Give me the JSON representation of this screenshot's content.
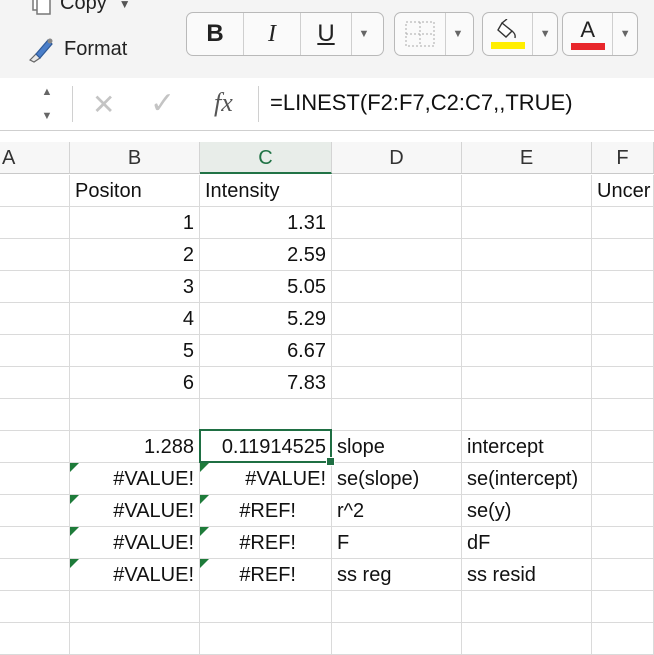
{
  "ribbon": {
    "copy_label": "Copy",
    "format_label": "Format",
    "bold_label": "B",
    "italic_label": "I",
    "underline_label": "U",
    "fill_color": "#ffee00",
    "font_color": "#e8262b",
    "font_color_glyph": "A"
  },
  "formula_bar": {
    "formula": "=LINEST(F2:F7,C2:C7,,TRUE)",
    "fx_label": "fx"
  },
  "columns": [
    "A",
    "B",
    "C",
    "D",
    "E",
    "F"
  ],
  "selected_column": "C",
  "rows": [
    {
      "B": "Positon",
      "C": "Intensity",
      "F": "Uncer"
    },
    {
      "B": "1",
      "C": "1.31"
    },
    {
      "B": "2",
      "C": "2.59"
    },
    {
      "B": "3",
      "C": "5.05"
    },
    {
      "B": "4",
      "C": "5.29"
    },
    {
      "B": "5",
      "C": "6.67"
    },
    {
      "B": "6",
      "C": "7.83"
    },
    {},
    {
      "B": "1.288",
      "C": "0.11914525",
      "D": "slope",
      "E": "intercept"
    },
    {
      "B": "#VALUE!",
      "C": "#VALUE!",
      "D": "se(slope)",
      "E": "se(intercept)"
    },
    {
      "B": "#VALUE!",
      "C": "#REF!",
      "D": "r^2",
      "E": "se(y)"
    },
    {
      "B": "#VALUE!",
      "C": "#REF!",
      "D": "F",
      "E": "dF"
    },
    {
      "B": "#VALUE!",
      "C": "#REF!",
      "D": "ss reg",
      "E": "ss resid"
    },
    {},
    {}
  ]
}
